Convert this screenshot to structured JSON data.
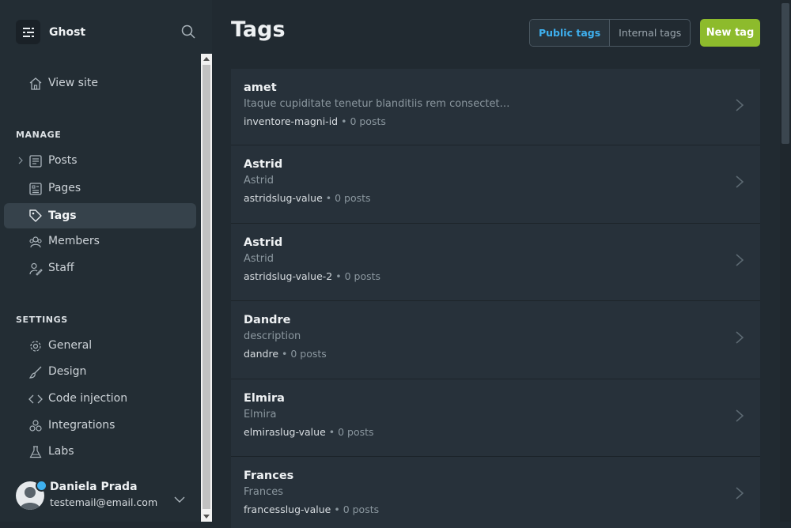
{
  "brand": {
    "name": "Ghost"
  },
  "nav": {
    "view_site": "View site",
    "manage_label": "MANAGE",
    "manage_items": [
      {
        "label": "Posts",
        "icon": "posts-icon"
      },
      {
        "label": "Pages",
        "icon": "pages-icon"
      },
      {
        "label": "Tags",
        "icon": "tag-icon",
        "active": true
      },
      {
        "label": "Members",
        "icon": "members-icon"
      },
      {
        "label": "Staff",
        "icon": "staff-icon"
      }
    ],
    "settings_label": "SETTINGS",
    "settings_items": [
      {
        "label": "General",
        "icon": "gear-icon"
      },
      {
        "label": "Design",
        "icon": "brush-icon"
      },
      {
        "label": "Code injection",
        "icon": "code-icon"
      },
      {
        "label": "Integrations",
        "icon": "integrations-icon"
      },
      {
        "label": "Labs",
        "icon": "flask-icon"
      }
    ]
  },
  "user": {
    "name": "Daniela Prada",
    "email": "testemail@email.com"
  },
  "header": {
    "title": "Tags",
    "public_tags": "Public tags",
    "internal_tags": "Internal tags",
    "new_tag": "New tag"
  },
  "tags": [
    {
      "name": "amet",
      "description": "Itaque cupiditate tenetur blanditiis rem consectet…",
      "slug": "inventore-magni-id",
      "count": "0 posts"
    },
    {
      "name": "Astrid",
      "description": "Astrid",
      "slug": "astridslug-value",
      "count": "0 posts"
    },
    {
      "name": "Astrid",
      "description": "Astrid",
      "slug": "astridslug-value-2",
      "count": "0 posts"
    },
    {
      "name": "Dandre",
      "description": "description",
      "slug": "dandre",
      "count": "0 posts"
    },
    {
      "name": "Elmira",
      "description": "Elmira",
      "slug": "elmiraslug-value",
      "count": "0 posts"
    },
    {
      "name": "Frances",
      "description": "Frances",
      "slug": "francesslug-value",
      "count": "0 posts"
    }
  ],
  "colors": {
    "accent": "#3eb0ef",
    "primary_button": "#8dbb2c",
    "sidebar_bg": "#232d34",
    "main_bg": "#212a31"
  }
}
